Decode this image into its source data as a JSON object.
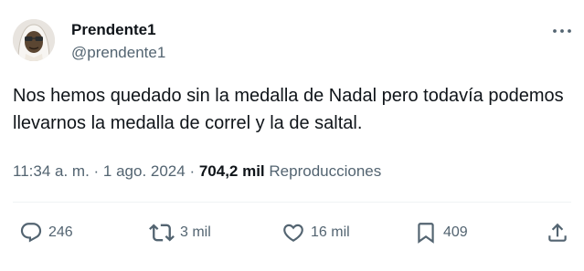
{
  "author": {
    "display_name": "Prendente1",
    "handle": "@prendente1",
    "avatar_icon": "profile-photo"
  },
  "tweet": {
    "text": "Nos hemos quedado sin la medalla de Nadal pero todavía podemos llevarnos la medalla de correl y la de saltal.",
    "time": "11:34 a. m.",
    "separator1": " · ",
    "date": "1 ago. 2024",
    "separator2": " · ",
    "views": "704,2 mil",
    "views_label": "Reproducciones"
  },
  "actions": {
    "replies": "246",
    "reposts": "3 mil",
    "likes": "16 mil",
    "bookmarks": "409"
  },
  "icons": {
    "more": "more-horizontal-icon",
    "reply": "reply-icon",
    "repost": "repost-icon",
    "like": "heart-icon",
    "bookmark": "bookmark-icon",
    "share": "share-icon"
  },
  "colors": {
    "text_primary": "#0f1419",
    "text_secondary": "#536471",
    "divider": "#eff3f4"
  }
}
